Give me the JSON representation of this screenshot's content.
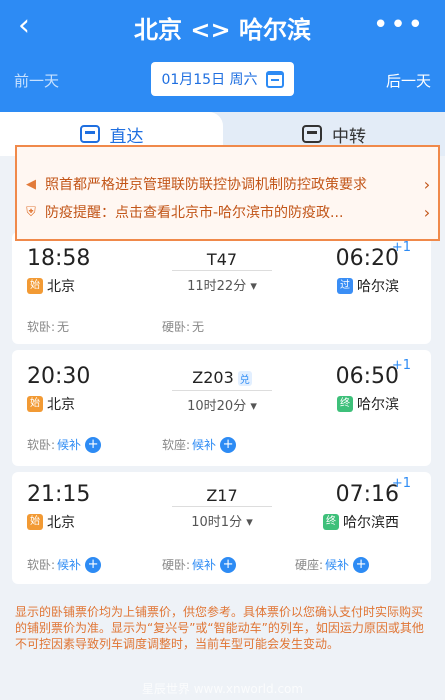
{
  "header": {
    "title": "北京 <> 哈尔滨",
    "back_icon": "chevron-left-icon",
    "more_label": "•••",
    "prev_day": "前一天",
    "next_day": "后一天",
    "date": "01月15日 周六"
  },
  "tabs": [
    {
      "label": "直达",
      "icon": "bus-icon"
    },
    {
      "label": "中转",
      "icon": "transfer-icon"
    }
  ],
  "notices": [
    {
      "icon": "speaker-icon",
      "text": "照首都严格进京管理联防联控协调机制防控政策要求"
    },
    {
      "icon": "shield-icon",
      "text": "防疫提醒：点击查看北京市-哈尔滨市的防疫政..."
    }
  ],
  "trains": [
    {
      "dep_time": "18:58",
      "arr_time": "06:20",
      "day_plus": "+1",
      "number": "T47",
      "fx": "",
      "duration": "11时22分",
      "from": "北京",
      "from_badge": "始",
      "to": "哈尔滨",
      "to_badge": "过",
      "seats": [
        {
          "name": "软卧:",
          "value": "无",
          "type": "none"
        },
        {
          "name": "硬卧:",
          "value": "无",
          "type": "none"
        }
      ]
    },
    {
      "dep_time": "20:30",
      "arr_time": "06:50",
      "day_plus": "+1",
      "number": "Z203",
      "fx": "兑",
      "duration": "10时20分",
      "from": "北京",
      "from_badge": "始",
      "to": "哈尔滨",
      "to_badge": "终",
      "seats": [
        {
          "name": "软卧:",
          "value": "候补",
          "type": "hb"
        },
        {
          "name": "软座:",
          "value": "候补",
          "type": "hb"
        }
      ]
    },
    {
      "dep_time": "21:15",
      "arr_time": "07:16",
      "day_plus": "+1",
      "number": "Z17",
      "fx": "",
      "duration": "10时1分",
      "from": "北京",
      "from_badge": "始",
      "to": "哈尔滨西",
      "to_badge": "终",
      "seats": [
        {
          "name": "软卧:",
          "value": "候补",
          "type": "hb"
        },
        {
          "name": "硬卧:",
          "value": "候补",
          "type": "hb"
        },
        {
          "name": "硬座:",
          "value": "候补",
          "type": "hb"
        }
      ]
    }
  ],
  "footer": "显示的卧铺票价均为上铺票价，供您参考。具体票价以您确认支付时实际购买的铺别票价为准。显示为“复兴号”或“智能动车”的列车，如因运力原因或其他不可控因素导致列车调度调整时，当前车型可能会发生变动。",
  "watermark": "星辰世界 www.xnworld.com"
}
